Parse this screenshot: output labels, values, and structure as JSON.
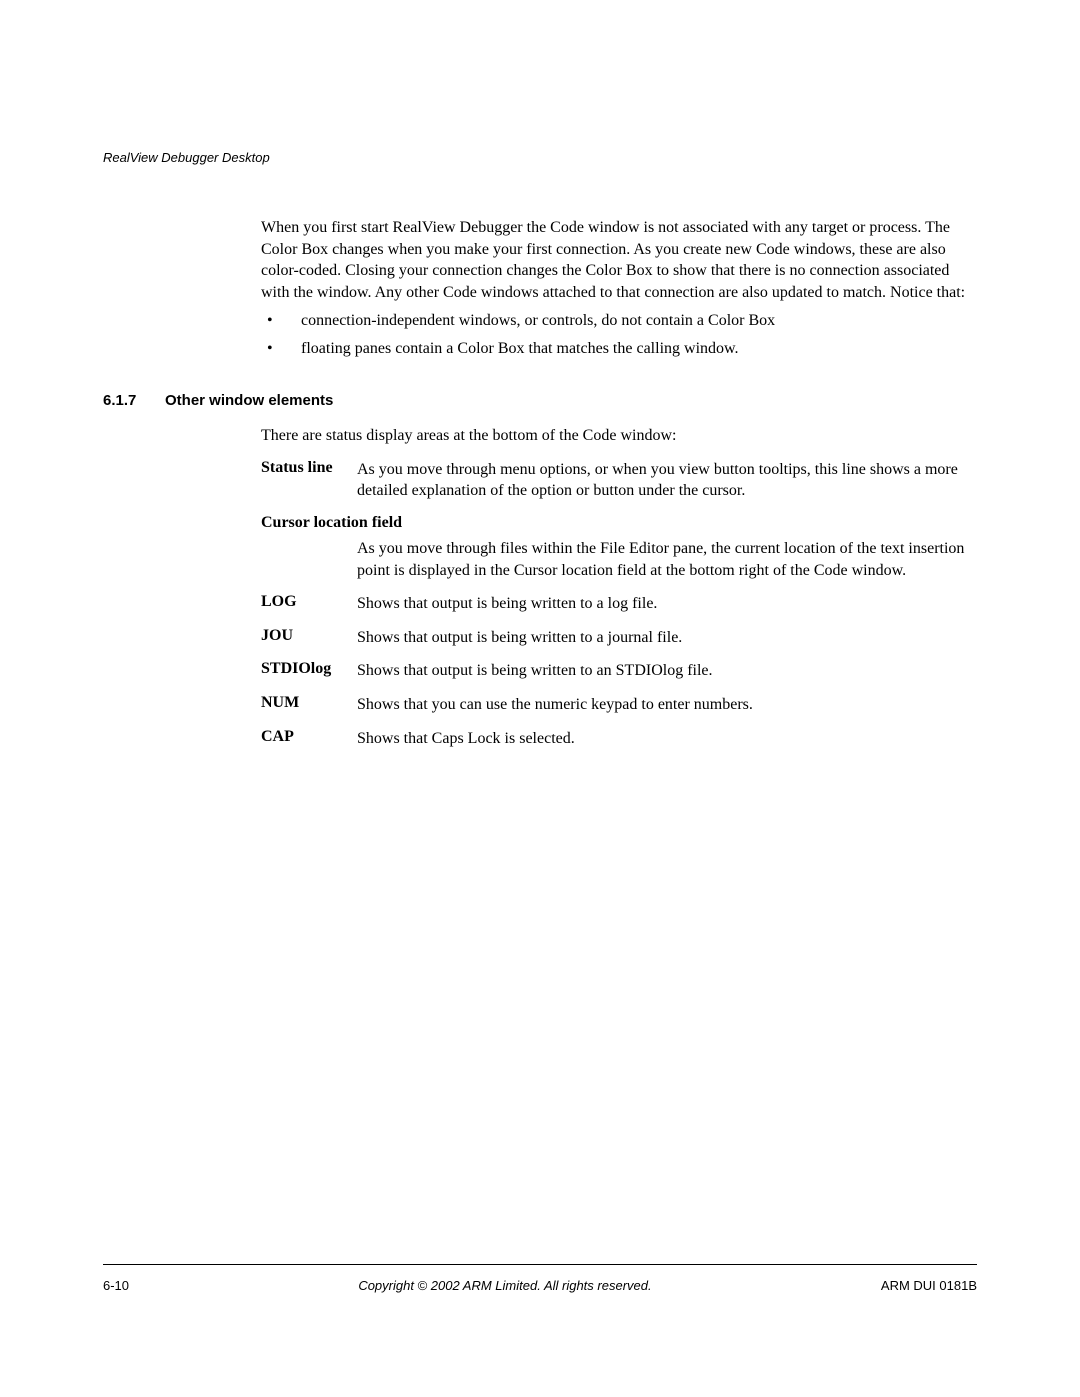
{
  "header": {
    "running_title": "RealView Debugger Desktop"
  },
  "intro": {
    "para": "When you first start RealView Debugger the Code window is not associated with any target or process. The Color Box changes when you make your first connection. As you create new Code windows, these are also color-coded. Closing your connection changes the Color Box to show that there is no connection associated with the window. Any other Code windows attached to that connection are also updated to match. Notice that:",
    "bullets": [
      "connection-independent windows, or controls, do not contain a Color Box",
      "floating panes contain a Color Box that matches the calling window."
    ]
  },
  "section": {
    "number": "6.1.7",
    "title": "Other window elements",
    "intro": "There are status display areas at the bottom of the Code window:"
  },
  "defs": {
    "status_line": {
      "term": "Status line",
      "desc": "As you move through menu options, or when you view button tooltips, this line shows a more detailed explanation of the option or button under the cursor."
    },
    "cursor_loc": {
      "term": "Cursor location field",
      "desc": "As you move through files within the File Editor pane, the current location of the text insertion point is displayed in the Cursor location field at the bottom right of the Code window."
    },
    "log": {
      "term": "LOG",
      "desc": "Shows that output is being written to a log file."
    },
    "jou": {
      "term": "JOU",
      "desc": "Shows that output is being written to a journal file."
    },
    "stdiolog": {
      "term": "STDIOlog",
      "desc": "Shows that output is being written to an STDIOlog file."
    },
    "num": {
      "term": "NUM",
      "desc": "Shows that you can use the numeric keypad to enter numbers."
    },
    "cap": {
      "term": "CAP",
      "desc": "Shows that Caps Lock is selected."
    }
  },
  "footer": {
    "page": "6-10",
    "copyright": "Copyright © 2002 ARM Limited. All rights reserved.",
    "doc_id": "ARM DUI 0181B"
  }
}
